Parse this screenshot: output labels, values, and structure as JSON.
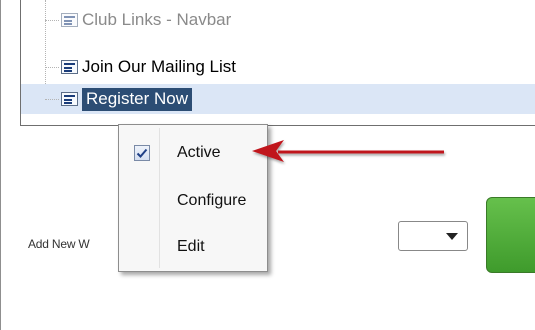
{
  "tree": {
    "items": [
      {
        "label": "Club Links - Navbar",
        "state": "dim"
      },
      {
        "label": "Join Our Mailing List",
        "state": "normal"
      },
      {
        "label": "Register Now",
        "state": "selected"
      }
    ]
  },
  "context_menu": {
    "items": [
      {
        "label": "Active",
        "checked": true
      },
      {
        "label": "Configure",
        "checked": false
      },
      {
        "label": "Edit",
        "checked": false
      }
    ]
  },
  "form": {
    "add_new_label": "Add New W"
  },
  "colors": {
    "selection_bg": "#2c4d74",
    "arrow": "#c0161c",
    "button_green": "#4fae39"
  }
}
